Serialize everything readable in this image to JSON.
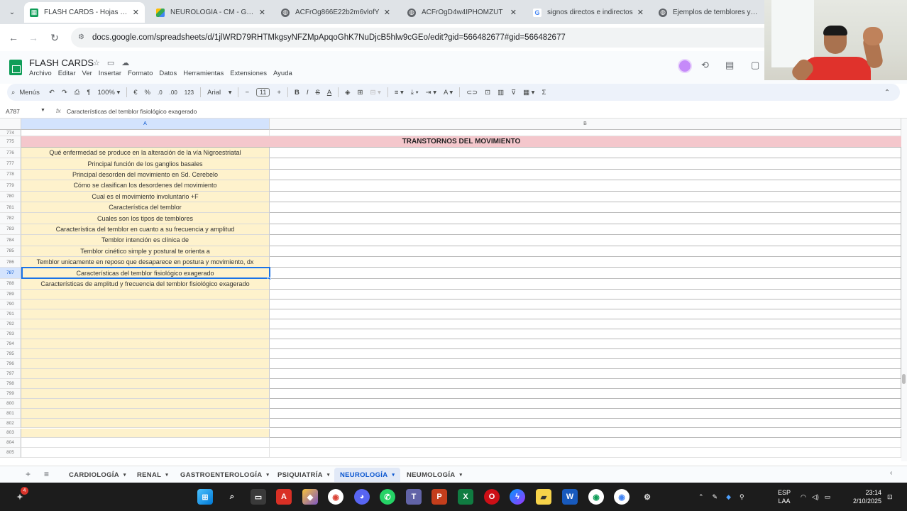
{
  "browser": {
    "tabs": [
      {
        "label": "FLASH CARDS - Hojas de cálculo de Google",
        "icon": "sheets-icon",
        "active": true
      },
      {
        "label": "NEUROLOGÍA - CM - Google Drive",
        "icon": "drive-icon",
        "active": false
      },
      {
        "label": "ACFrOg866E22b2m6vlofY",
        "icon": "globe-icon",
        "active": false
      },
      {
        "label": "ACFrOgD4w4IPHOMZUT",
        "icon": "globe-icon",
        "active": false
      },
      {
        "label": "signos directos e indirectos",
        "icon": "google-icon",
        "active": false
      },
      {
        "label": "Ejemplos de temblores y su",
        "icon": "globe-icon",
        "active": false
      }
    ],
    "url": "docs.google.com/spreadsheets/d/1jlWRD79RHTMkgsyNFZMpApqoGhK7NuDjcB5hlw9cGEo/edit?gid=566482677#gid=566482677"
  },
  "sheets": {
    "title": "FLASH CARDS",
    "menu": [
      "Archivo",
      "Editar",
      "Ver",
      "Insertar",
      "Formato",
      "Datos",
      "Herramientas",
      "Extensiones",
      "Ayuda"
    ],
    "toolbar": {
      "search_label": "Menús",
      "zoom": "100%",
      "currency": "€",
      "percent": "%",
      "decimal_dec": ".0",
      "decimal_inc": ".00",
      "format_123": "123",
      "font": "Arial",
      "font_size": "11"
    },
    "name_box": "A787",
    "formula": "Características del temblor fisiológico exagerado",
    "columns": {
      "a": "A",
      "b": "B"
    },
    "header_row": {
      "num": "775",
      "text": "TRANSTORNOS DEL MOVIMIENTO"
    },
    "first_row_num": "774",
    "rows": [
      {
        "num": "776",
        "text": "Qué enfermedad se produce en la alteración de la vía Nigroestriatal"
      },
      {
        "num": "777",
        "text": "Principal función de los ganglios basales"
      },
      {
        "num": "778",
        "text": "Principal desorden del movimiento en Sd. Cerebelo"
      },
      {
        "num": "779",
        "text": "Cómo se clasifican los desordenes del movimiento"
      },
      {
        "num": "780",
        "text": "Cual es el movimiento involuntario +F"
      },
      {
        "num": "781",
        "text": "Característica del temblor"
      },
      {
        "num": "782",
        "text": "Cuales son los tipos de temblores"
      },
      {
        "num": "783",
        "text": "Característica del temblor en cuanto a su frecuencia y amplitud"
      },
      {
        "num": "784",
        "text": "Temblor intención es clínica de"
      },
      {
        "num": "785",
        "text": "Temblor cinético simple y postural te orienta a"
      },
      {
        "num": "786",
        "text": "Temblor unicamente en reposo que desaparece en postura y movimiento, dx"
      },
      {
        "num": "787",
        "text": "Características del temblor fisiológico exagerado"
      },
      {
        "num": "788",
        "text": "Características de amplitud y frecuencia del temblor fisiológico exagerado"
      }
    ],
    "empty_rows": [
      "789",
      "790",
      "791",
      "792",
      "793",
      "794",
      "795",
      "796",
      "797",
      "798",
      "799",
      "800",
      "801",
      "802",
      "803"
    ],
    "after_rows": [
      "804",
      "805"
    ],
    "sheet_tabs": [
      {
        "label": "CARDIOLOGÍA",
        "active": false
      },
      {
        "label": "RENAL",
        "active": false
      },
      {
        "label": "GASTROENTEROLOGÍA",
        "active": false
      },
      {
        "label": "PSIQUIATRÍA",
        "active": false
      },
      {
        "label": "NEUROLOGÍA",
        "active": true
      },
      {
        "label": "NEUMOLOGÍA",
        "active": false
      }
    ]
  },
  "taskbar": {
    "badge": "4",
    "language": "ESP",
    "layout": "LAA",
    "time": "23:14",
    "date": "2/10/2025"
  },
  "colors": {
    "header_pink": "#f4c7cc",
    "column_a_yellow": "#fef2cc",
    "selection_blue": "#1a73e8",
    "sheets_green": "#0f9d58"
  }
}
